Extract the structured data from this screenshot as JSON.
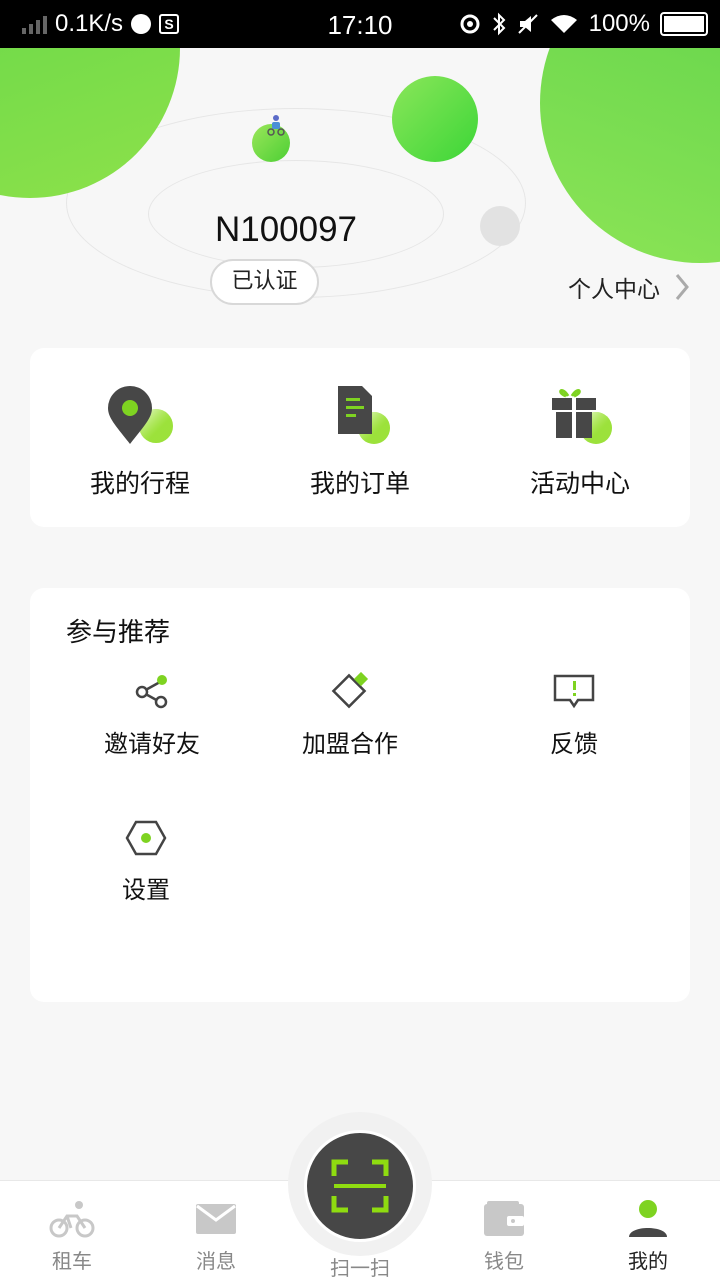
{
  "status": {
    "speed": "0.1K/s",
    "time": "17:10",
    "battery": "100%"
  },
  "profile": {
    "username": "N100097",
    "verified_label": "已认证",
    "personal_center_label": "个人中心"
  },
  "quick_actions": [
    {
      "label": "我的行程",
      "icon": "location-pin-icon"
    },
    {
      "label": "我的订单",
      "icon": "order-document-icon"
    },
    {
      "label": "活动中心",
      "icon": "gift-icon"
    }
  ],
  "recommend": {
    "title": "参与推荐",
    "items": [
      {
        "label": "邀请好友",
        "icon": "share-icon"
      },
      {
        "label": "加盟合作",
        "icon": "diamond-tag-icon"
      },
      {
        "label": "反馈",
        "icon": "feedback-icon"
      },
      {
        "label": "设置",
        "icon": "hexagon-settings-icon"
      }
    ]
  },
  "bottom_nav": {
    "tabs": [
      {
        "label": "租车",
        "icon": "bicycle-icon"
      },
      {
        "label": "消息",
        "icon": "envelope-icon"
      },
      {
        "label": "扫一扫",
        "icon": "scan-icon"
      },
      {
        "label": "钱包",
        "icon": "wallet-icon"
      },
      {
        "label": "我的",
        "icon": "user-icon"
      }
    ],
    "active": "我的"
  },
  "colors": {
    "accent_green": "#7ed321",
    "icon_dark": "#474747"
  }
}
